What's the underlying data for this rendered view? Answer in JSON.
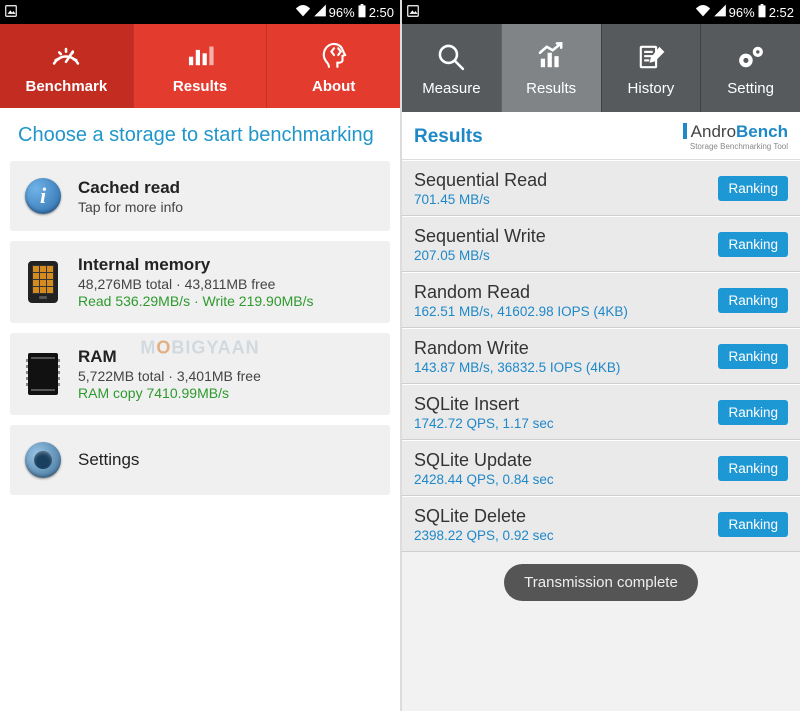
{
  "watermark": "MOBIGYAAN",
  "left_phone": {
    "status": {
      "battery_pct": "96%",
      "time": "2:50"
    },
    "tabs": [
      {
        "label": "Benchmark",
        "active": true
      },
      {
        "label": "Results",
        "active": false
      },
      {
        "label": "About",
        "active": false
      }
    ],
    "heading": "Choose a storage to start benchmarking",
    "cards": {
      "cached": {
        "title": "Cached read",
        "sub": "Tap for more info"
      },
      "internal": {
        "title": "Internal memory",
        "sub": "48,276MB total · 43,811MB free",
        "green": "Read 536.29MB/s · Write 219.90MB/s"
      },
      "ram": {
        "title": "RAM",
        "sub": "5,722MB total · 3,401MB free",
        "green": "RAM copy 7410.99MB/s"
      },
      "settings": {
        "title": "Settings"
      }
    }
  },
  "right_phone": {
    "status": {
      "battery_pct": "96%",
      "time": "2:52"
    },
    "tabs": [
      {
        "label": "Measure",
        "active": false
      },
      {
        "label": "Results",
        "active": true
      },
      {
        "label": "History",
        "active": false
      },
      {
        "label": "Setting",
        "active": false
      }
    ],
    "header_title": "Results",
    "logo": {
      "line1_pre": "Andro",
      "line1_post": "Bench",
      "line2": "Storage Benchmarking Tool"
    },
    "ranking_label": "Ranking",
    "rows": [
      {
        "title": "Sequential Read",
        "sub": "701.45 MB/s"
      },
      {
        "title": "Sequential Write",
        "sub": "207.05 MB/s"
      },
      {
        "title": "Random Read",
        "sub": "162.51 MB/s, 41602.98 IOPS (4KB)"
      },
      {
        "title": "Random Write",
        "sub": "143.87 MB/s, 36832.5 IOPS (4KB)"
      },
      {
        "title": "SQLite Insert",
        "sub": "1742.72 QPS, 1.17 sec"
      },
      {
        "title": "SQLite Update",
        "sub": "2428.44 QPS, 0.84 sec"
      },
      {
        "title": "SQLite Delete",
        "sub": "2398.22 QPS, 0.92 sec"
      }
    ],
    "toast": "Transmission complete"
  }
}
